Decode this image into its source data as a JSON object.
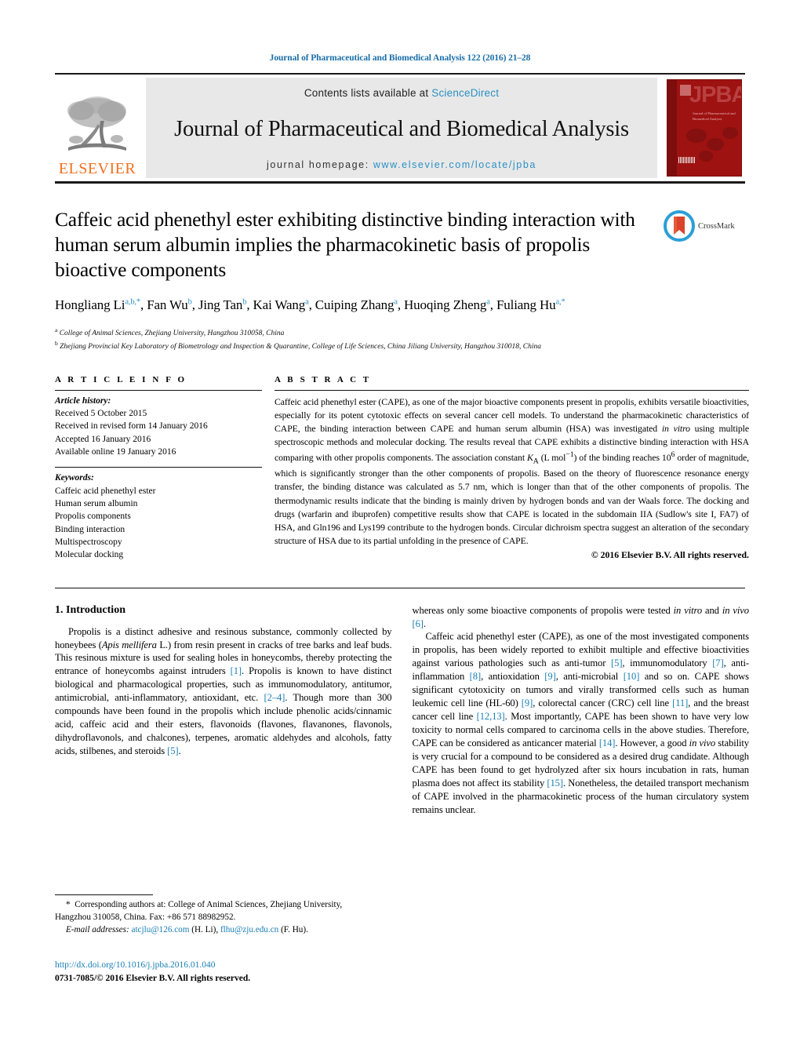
{
  "running_head": "Journal of Pharmaceutical and Biomedical Analysis 122 (2016) 21–28",
  "masthead": {
    "publisher": "ELSEVIER",
    "contents_prefix": "Contents lists available at ",
    "contents_link": "ScienceDirect",
    "journal_title": "Journal of Pharmaceutical and Biomedical Analysis",
    "homepage_prefix": "journal homepage: ",
    "homepage_url": "www.elsevier.com/locate/jpba",
    "cover_title": "JPBA",
    "cover_subtitle": "Journal of Pharmaceutical and Biomedical Analysis"
  },
  "article": {
    "title": "Caffeic acid phenethyl ester exhibiting distinctive binding interaction with human serum albumin implies the pharmacokinetic basis of propolis bioactive components",
    "crossmark_label": "CrossMark",
    "authors_html": "Hongliang Li<sup>a,b,*</sup>, Fan Wu<sup>b</sup>, Jing Tan<sup>b</sup>, Kai Wang<sup>a</sup>, Cuiping Zhang<sup>a</sup>, Huoqing Zheng<sup>a</sup>, Fuliang Hu<sup>a,*</sup>",
    "affiliation_a": "College of Animal Sciences, Zhejiang University, Hangzhou 310058, China",
    "affiliation_b": "Zhejiang Provincial Key Laboratory of Biometrology and Inspection & Quarantine, College of Life Sciences, China Jiliang University, Hangzhou 310018, China"
  },
  "article_info": {
    "heading": "A R T I C L E   I N F O",
    "history_label": "Article history:",
    "history": [
      "Received 5 October 2015",
      "Received in revised form 14 January 2016",
      "Accepted 16 January 2016",
      "Available online 19 January 2016"
    ],
    "keywords_label": "Keywords:",
    "keywords": [
      "Caffeic acid phenethyl ester",
      "Human serum albumin",
      "Propolis components",
      "Binding interaction",
      "Multispectroscopy",
      "Molecular docking"
    ]
  },
  "abstract": {
    "heading": "A B S T R A C T",
    "text_html": "Caffeic acid phenethyl ester (CAPE), as one of the major bioactive components present in propolis, exhibits versatile bioactivities, especially for its potent cytotoxic effects on several cancer cell models. To understand the pharmacokinetic characteristics of CAPE, the binding interaction between CAPE and human serum albumin (HSA) was investigated <i>in vitro</i> using multiple spectroscopic methods and molecular docking. The results reveal that CAPE exhibits a distinctive binding interaction with HSA comparing with other propolis components. The association constant <i>K</i><sub>A</sub> (L mol<sup>−1</sup>) of the binding reaches 10<sup>6</sup> order of magnitude, which is significantly stronger than the other components of propolis. Based on the theory of fluorescence resonance energy transfer, the binding distance was calculated as 5.7 nm, which is longer than that of the other components of propolis. The thermodynamic results indicate that the binding is mainly driven by hydrogen bonds and van der Waals force. The docking and drugs (warfarin and ibuprofen) competitive results show that CAPE is located in the subdomain IIA (Sudlow's site I, FA7) of HSA, and Gln196 and Lys199 contribute to the hydrogen bonds. Circular dichroism spectra suggest an alteration of the secondary structure of HSA due to its partial unfolding in the presence of CAPE.",
    "copyright": "© 2016 Elsevier B.V. All rights reserved."
  },
  "body": {
    "section_number_title": "1.  Introduction",
    "left_paragraph_html": "Propolis is a distinct adhesive and resinous substance, commonly collected by honeybees (<i>Apis mellifera</i> L.) from resin present in cracks of tree barks and leaf buds. This resinous mixture is used for sealing holes in honeycombs, thereby protecting the entrance of honeycombs against intruders <span class=\"ref\">[1]</span>. Propolis is known to have distinct biological and pharmacological properties, such as immunomodulatory, antitumor, antimicrobial, anti-inflammatory, antioxidant, etc. <span class=\"ref\">[2–4]</span>. Though more than 300 compounds have been found in the propolis which include phenolic acids/cinnamic acid, caffeic acid and their esters, flavonoids (flavones, flavanones, flavonols, dihydroflavonols, and chalcones), terpenes, aromatic aldehydes and alcohols, fatty acids, stilbenes, and steroids <span class=\"ref\">[5]</span>.",
    "right_paragraph1_html": "whereas only some bioactive components of propolis were tested <i>in vitro</i> and <i>in vivo</i> <span class=\"ref\">[6]</span>.",
    "right_paragraph2_html": "Caffeic acid phenethyl ester (CAPE), as one of the most investigated components in propolis, has been widely reported to exhibit multiple and effective bioactivities against various pathologies such as anti-tumor <span class=\"ref\">[5]</span>, immunomodulatory <span class=\"ref\">[7]</span>, anti-inflammation <span class=\"ref\">[8]</span>, antioxidation <span class=\"ref\">[9]</span>, anti-microbial <span class=\"ref\">[10]</span> and so on. CAPE shows significant cytotoxicity on tumors and virally transformed cells such as human leukemic cell line (HL-60) <span class=\"ref\">[9]</span>, colorectal cancer (CRC) cell line <span class=\"ref\">[11]</span>, and the breast cancer cell line <span class=\"ref\">[12,13]</span>. Most importantly, CAPE has been shown to have very low toxicity to normal cells compared to carcinoma cells in the above studies. Therefore, CAPE can be considered as anticancer material <span class=\"ref\">[14]</span>. However, a good <i>in vivo</i> stability is very crucial for a compound to be considered as a desired drug candidate. Although CAPE has been found to get hydrolyzed after six hours incubation in rats, human plasma does not affect its stability <span class=\"ref\">[15]</span>. Nonetheless, the detailed transport mechanism of CAPE involved in the pharmacokinetic process of the human circulatory system remains unclear."
  },
  "footnotes": {
    "corresponding_html": "<span class=\"star\">*</span>&nbsp; Corresponding authors at: College of Animal Sciences, Zhejiang University, Hangzhou 310058, China. Fax: +86 571 88982952.",
    "email_label": "E-mail addresses:",
    "email_1": "atcjlu@126.com",
    "email_1_owner": "(H. Li)",
    "email_2": "flhu@zju.edu.cn",
    "email_2_owner": "(F. Hu)",
    "doi_url": "http://dx.doi.org/10.1016/j.jpba.2016.01.040",
    "issn_line": "0731-7085/© 2016 Elsevier B.V. All rights reserved."
  },
  "colors": {
    "link_blue": "#1a7fb5",
    "elsevier_orange": "#f37021",
    "cover_red": "#9e1212"
  }
}
